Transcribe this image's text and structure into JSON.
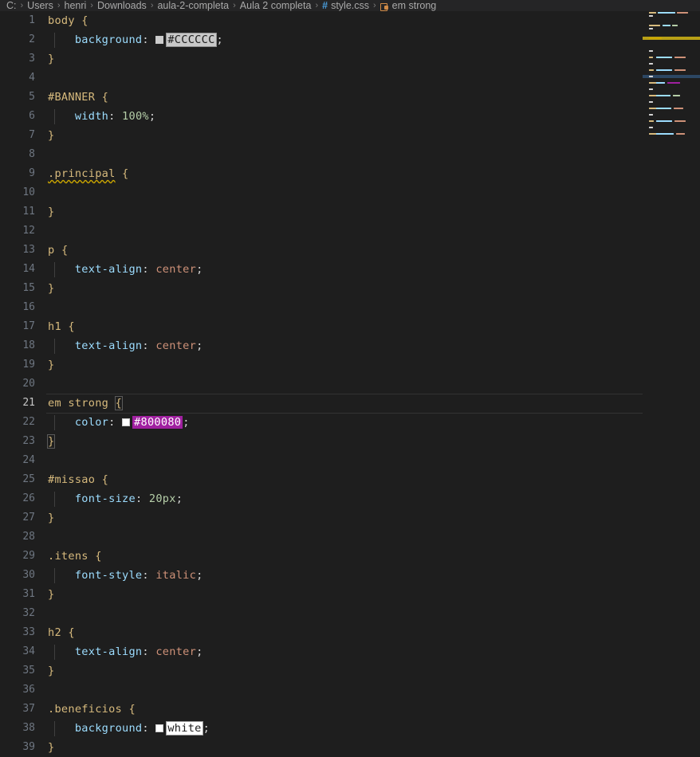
{
  "breadcrumb": {
    "segments": [
      "C:",
      "Users",
      "henri",
      "Downloads",
      "aula-2-completa",
      "Aula 2 completa"
    ],
    "file": "style.css",
    "symbol": "em strong",
    "file_icon": "css-hash-icon",
    "symbol_icon": "css-selector-icon",
    "separator": "›"
  },
  "editor": {
    "language": "css",
    "active_line": 21,
    "warning_line": 9,
    "lines": [
      {
        "n": "1",
        "tokens": [
          {
            "t": "body",
            "c": "sel"
          },
          {
            "t": " ",
            "c": "punc"
          },
          {
            "t": "{",
            "c": "brace"
          }
        ]
      },
      {
        "n": "2",
        "indent": true,
        "tokens": [
          {
            "t": "    ",
            "c": "punc"
          },
          {
            "t": "background",
            "c": "prop"
          },
          {
            "t": ":",
            "c": "punc"
          },
          {
            "t": " ",
            "c": "punc"
          },
          {
            "t": "swatch",
            "c": "chip",
            "color": "#cccccc"
          },
          {
            "t": "#CCCCCC",
            "c": "hl-gray"
          },
          {
            "t": ";",
            "c": "punc"
          }
        ]
      },
      {
        "n": "3",
        "tokens": [
          {
            "t": "}",
            "c": "brace"
          }
        ]
      },
      {
        "n": "4",
        "tokens": []
      },
      {
        "n": "5",
        "tokens": [
          {
            "t": "#BANNER",
            "c": "sel"
          },
          {
            "t": " ",
            "c": "punc"
          },
          {
            "t": "{",
            "c": "brace"
          }
        ]
      },
      {
        "n": "6",
        "indent": true,
        "tokens": [
          {
            "t": "    ",
            "c": "punc"
          },
          {
            "t": "width",
            "c": "prop"
          },
          {
            "t": ":",
            "c": "punc"
          },
          {
            "t": " ",
            "c": "punc"
          },
          {
            "t": "100%",
            "c": "num"
          },
          {
            "t": ";",
            "c": "punc"
          }
        ]
      },
      {
        "n": "7",
        "tokens": [
          {
            "t": "}",
            "c": "brace"
          }
        ]
      },
      {
        "n": "8",
        "tokens": []
      },
      {
        "n": "9",
        "tokens": [
          {
            "t": ".principal",
            "c": "sel squig"
          },
          {
            "t": " ",
            "c": "punc"
          },
          {
            "t": "{",
            "c": "brace"
          }
        ]
      },
      {
        "n": "10",
        "tokens": []
      },
      {
        "n": "11",
        "tokens": [
          {
            "t": "}",
            "c": "brace"
          }
        ]
      },
      {
        "n": "12",
        "tokens": []
      },
      {
        "n": "13",
        "tokens": [
          {
            "t": "p",
            "c": "sel"
          },
          {
            "t": " ",
            "c": "punc"
          },
          {
            "t": "{",
            "c": "brace"
          }
        ]
      },
      {
        "n": "14",
        "indent": true,
        "tokens": [
          {
            "t": "    ",
            "c": "punc"
          },
          {
            "t": "text-align",
            "c": "prop"
          },
          {
            "t": ":",
            "c": "punc"
          },
          {
            "t": " ",
            "c": "punc"
          },
          {
            "t": "center",
            "c": "val"
          },
          {
            "t": ";",
            "c": "punc"
          }
        ]
      },
      {
        "n": "15",
        "tokens": [
          {
            "t": "}",
            "c": "brace"
          }
        ]
      },
      {
        "n": "16",
        "tokens": []
      },
      {
        "n": "17",
        "tokens": [
          {
            "t": "h1",
            "c": "sel"
          },
          {
            "t": " ",
            "c": "punc"
          },
          {
            "t": "{",
            "c": "brace"
          }
        ]
      },
      {
        "n": "18",
        "indent": true,
        "tokens": [
          {
            "t": "    ",
            "c": "punc"
          },
          {
            "t": "text-align",
            "c": "prop"
          },
          {
            "t": ":",
            "c": "punc"
          },
          {
            "t": " ",
            "c": "punc"
          },
          {
            "t": "center",
            "c": "val"
          },
          {
            "t": ";",
            "c": "punc"
          }
        ]
      },
      {
        "n": "19",
        "tokens": [
          {
            "t": "}",
            "c": "brace"
          }
        ]
      },
      {
        "n": "20",
        "tokens": []
      },
      {
        "n": "21",
        "active": true,
        "tokens": [
          {
            "t": "em strong",
            "c": "sel"
          },
          {
            "t": " ",
            "c": "punc"
          },
          {
            "t": "{",
            "c": "brace bmatch"
          }
        ]
      },
      {
        "n": "22",
        "indent": true,
        "tokens": [
          {
            "t": "    ",
            "c": "punc"
          },
          {
            "t": "color",
            "c": "prop"
          },
          {
            "t": ":",
            "c": "punc"
          },
          {
            "t": " ",
            "c": "punc"
          },
          {
            "t": "swatch",
            "c": "chip",
            "color": "#ffffff"
          },
          {
            "t": "#800080",
            "c": "hl-purple"
          },
          {
            "t": ";",
            "c": "punc"
          }
        ]
      },
      {
        "n": "23",
        "tokens": [
          {
            "t": "}",
            "c": "brace bmatch"
          }
        ]
      },
      {
        "n": "24",
        "tokens": []
      },
      {
        "n": "25",
        "tokens": [
          {
            "t": "#missao",
            "c": "sel"
          },
          {
            "t": " ",
            "c": "punc"
          },
          {
            "t": "{",
            "c": "brace"
          }
        ]
      },
      {
        "n": "26",
        "indent": true,
        "tokens": [
          {
            "t": "    ",
            "c": "punc"
          },
          {
            "t": "font-size",
            "c": "prop"
          },
          {
            "t": ":",
            "c": "punc"
          },
          {
            "t": " ",
            "c": "punc"
          },
          {
            "t": "20px",
            "c": "num"
          },
          {
            "t": ";",
            "c": "punc"
          }
        ]
      },
      {
        "n": "27",
        "tokens": [
          {
            "t": "}",
            "c": "brace"
          }
        ]
      },
      {
        "n": "28",
        "tokens": []
      },
      {
        "n": "29",
        "tokens": [
          {
            "t": ".itens",
            "c": "sel"
          },
          {
            "t": " ",
            "c": "punc"
          },
          {
            "t": "{",
            "c": "brace"
          }
        ]
      },
      {
        "n": "30",
        "indent": true,
        "tokens": [
          {
            "t": "    ",
            "c": "punc"
          },
          {
            "t": "font-style",
            "c": "prop"
          },
          {
            "t": ":",
            "c": "punc"
          },
          {
            "t": " ",
            "c": "punc"
          },
          {
            "t": "italic",
            "c": "val"
          },
          {
            "t": ";",
            "c": "punc"
          }
        ]
      },
      {
        "n": "31",
        "tokens": [
          {
            "t": "}",
            "c": "brace"
          }
        ]
      },
      {
        "n": "32",
        "tokens": []
      },
      {
        "n": "33",
        "tokens": [
          {
            "t": "h2",
            "c": "sel"
          },
          {
            "t": " ",
            "c": "punc"
          },
          {
            "t": "{",
            "c": "brace"
          }
        ]
      },
      {
        "n": "34",
        "indent": true,
        "tokens": [
          {
            "t": "    ",
            "c": "punc"
          },
          {
            "t": "text-align",
            "c": "prop"
          },
          {
            "t": ":",
            "c": "punc"
          },
          {
            "t": " ",
            "c": "punc"
          },
          {
            "t": "center",
            "c": "val"
          },
          {
            "t": ";",
            "c": "punc"
          }
        ]
      },
      {
        "n": "35",
        "tokens": [
          {
            "t": "}",
            "c": "brace"
          }
        ]
      },
      {
        "n": "36",
        "tokens": []
      },
      {
        "n": "37",
        "tokens": [
          {
            "t": ".beneficios",
            "c": "sel"
          },
          {
            "t": " ",
            "c": "punc"
          },
          {
            "t": "{",
            "c": "brace"
          }
        ]
      },
      {
        "n": "38",
        "indent": true,
        "tokens": [
          {
            "t": "    ",
            "c": "punc"
          },
          {
            "t": "background",
            "c": "prop"
          },
          {
            "t": ":",
            "c": "punc"
          },
          {
            "t": " ",
            "c": "punc"
          },
          {
            "t": "swatch",
            "c": "chip",
            "color": "#ffffff"
          },
          {
            "t": "white",
            "c": "hl-white"
          },
          {
            "t": ";",
            "c": "punc"
          }
        ]
      },
      {
        "n": "39",
        "tokens": [
          {
            "t": "}",
            "c": "brace"
          }
        ]
      }
    ]
  },
  "minimap": {
    "warning_row": 9,
    "current_row": 21,
    "rows": [
      [
        [
          2,
          9,
          "#d7ba7d"
        ],
        [
          13,
          22,
          "#9cdcfe"
        ],
        [
          37,
          14,
          "#ce9178"
        ]
      ],
      [
        [
          2,
          5,
          "#d4d4d4"
        ]
      ],
      [],
      [
        [
          2,
          14,
          "#d7ba7d"
        ],
        [
          19,
          10,
          "#9cdcfe"
        ],
        [
          31,
          7,
          "#b5cea8"
        ]
      ],
      [
        [
          2,
          5,
          "#d4d4d4"
        ]
      ],
      [],
      [
        [
          2,
          16,
          "#cca700"
        ]
      ],
      [],
      [
        [
          2,
          5,
          "#d4d4d4"
        ]
      ],
      [],
      [
        [
          2,
          5,
          "#d7ba7d"
        ],
        [
          11,
          20,
          "#9cdcfe"
        ],
        [
          34,
          14,
          "#ce9178"
        ]
      ],
      [
        [
          2,
          5,
          "#d4d4d4"
        ]
      ],
      [],
      [
        [
          2,
          6,
          "#d7ba7d"
        ],
        [
          11,
          20,
          "#9cdcfe"
        ],
        [
          34,
          14,
          "#ce9178"
        ]
      ],
      [
        [
          2,
          5,
          "#d4d4d4"
        ]
      ],
      [],
      [
        [
          2,
          17,
          "#d7ba7d"
        ],
        [
          11,
          11,
          "#9cdcfe"
        ],
        [
          25,
          16,
          "#a020a0"
        ]
      ],
      [
        [
          2,
          5,
          "#d4d4d4"
        ]
      ],
      [],
      [
        [
          2,
          13,
          "#d7ba7d"
        ],
        [
          11,
          18,
          "#9cdcfe"
        ],
        [
          32,
          9,
          "#b5cea8"
        ]
      ],
      [
        [
          2,
          5,
          "#d4d4d4"
        ]
      ],
      [],
      [
        [
          2,
          11,
          "#d7ba7d"
        ],
        [
          11,
          19,
          "#9cdcfe"
        ],
        [
          33,
          12,
          "#ce9178"
        ]
      ],
      [
        [
          2,
          5,
          "#d4d4d4"
        ]
      ],
      [],
      [
        [
          2,
          6,
          "#d7ba7d"
        ],
        [
          11,
          20,
          "#9cdcfe"
        ],
        [
          34,
          14,
          "#ce9178"
        ]
      ],
      [
        [
          2,
          5,
          "#d4d4d4"
        ]
      ],
      [],
      [
        [
          2,
          20,
          "#d7ba7d"
        ],
        [
          11,
          22,
          "#9cdcfe"
        ],
        [
          36,
          11,
          "#ce9178"
        ]
      ],
      [
        [
          2,
          5,
          "#d4d4d4"
        ]
      ]
    ]
  }
}
